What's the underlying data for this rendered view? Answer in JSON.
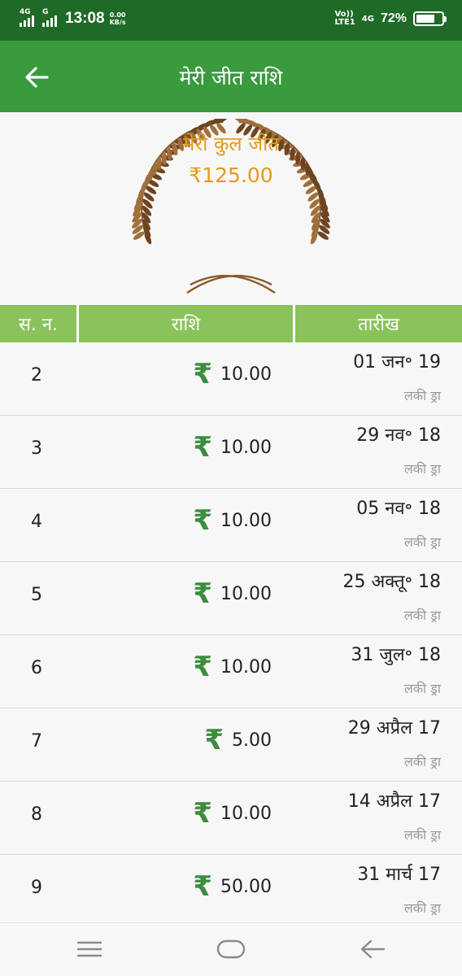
{
  "status_bar": {
    "sim1_label": "4G",
    "sim2_label": "G",
    "time": "13:08",
    "speed_value": "0.00",
    "speed_unit": "KB/s",
    "volte_top": "Vo))",
    "volte_bottom": "LTE1",
    "net_label": "4G",
    "battery_percent": "72%",
    "battery_level": 0.72
  },
  "app_bar": {
    "title": "मेरी जीत राशि"
  },
  "summary": {
    "label": "मेरी कुल जीत",
    "amount": "₹125.00"
  },
  "table": {
    "headers": [
      "स. न.",
      "राशि",
      "तारीख"
    ],
    "rows": [
      {
        "sn": "2",
        "amount": "10.00",
        "date": "01 जन॰ 19",
        "type": "लकी ड्रा"
      },
      {
        "sn": "3",
        "amount": "10.00",
        "date": "29 नव॰ 18",
        "type": "लकी ड्रा"
      },
      {
        "sn": "4",
        "amount": "10.00",
        "date": "05 नव॰ 18",
        "type": "लकी ड्रा"
      },
      {
        "sn": "5",
        "amount": "10.00",
        "date": "25 अक्तू॰ 18",
        "type": "लकी ड्रा"
      },
      {
        "sn": "6",
        "amount": "10.00",
        "date": "31 जुल॰ 18",
        "type": "लकी ड्रा"
      },
      {
        "sn": "7",
        "amount": "5.00",
        "date": "29 अप्रैल 17",
        "type": "लकी ड्रा"
      },
      {
        "sn": "8",
        "amount": "10.00",
        "date": "14 अप्रैल 17",
        "type": "लकी ड्रा"
      },
      {
        "sn": "9",
        "amount": "50.00",
        "date": "31 मार्च 17",
        "type": "लकी ड्रा"
      }
    ],
    "currency_symbol": "₹"
  },
  "colors": {
    "status_bar": "#1f6a26",
    "app_bar": "#3a9a3e",
    "table_header": "#8bc35b",
    "summary_text": "#e39b1e",
    "rupee_icon": "#3d8c3f",
    "laurel": "#8a5a2b"
  },
  "icons": {
    "back": "back-arrow-icon",
    "laurel": "laurel-wreath-icon",
    "rupee": "rupee-icon",
    "nav_menu": "menu-icon",
    "nav_home": "home-icon",
    "nav_back": "back-icon"
  }
}
